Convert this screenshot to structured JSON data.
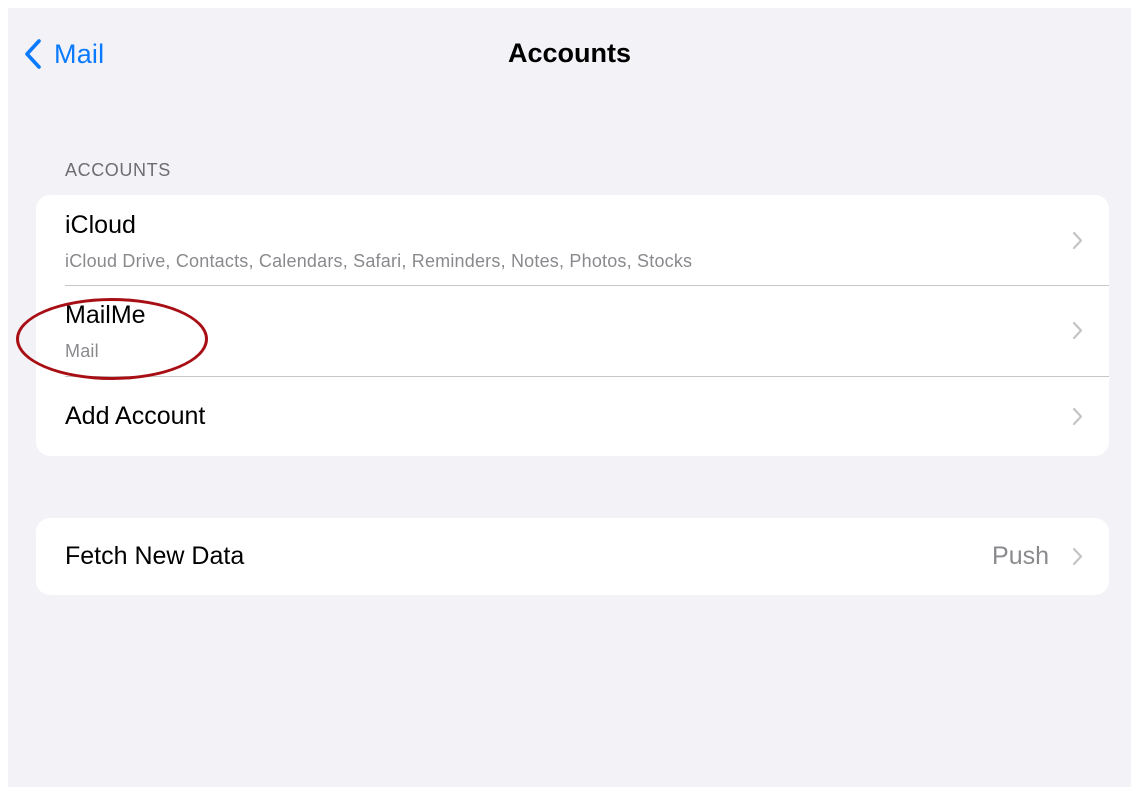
{
  "navbar": {
    "back_label": "Mail",
    "title": "Accounts"
  },
  "accounts_section": {
    "header": "ACCOUNTS",
    "rows": [
      {
        "title": "iCloud",
        "subtitle": "iCloud Drive, Contacts, Calendars, Safari, Reminders, Notes, Photos, Stocks"
      },
      {
        "title": "MailMe",
        "subtitle": "Mail"
      },
      {
        "title": "Add Account"
      }
    ]
  },
  "fetch_section": {
    "title": "Fetch New Data",
    "value": "Push"
  },
  "icons": {
    "back": "chevron-left-icon",
    "disclosure": "chevron-right-icon"
  },
  "colors": {
    "accent": "#0a7aff",
    "background": "#f2f2f7",
    "annotation": "#a80f14"
  }
}
